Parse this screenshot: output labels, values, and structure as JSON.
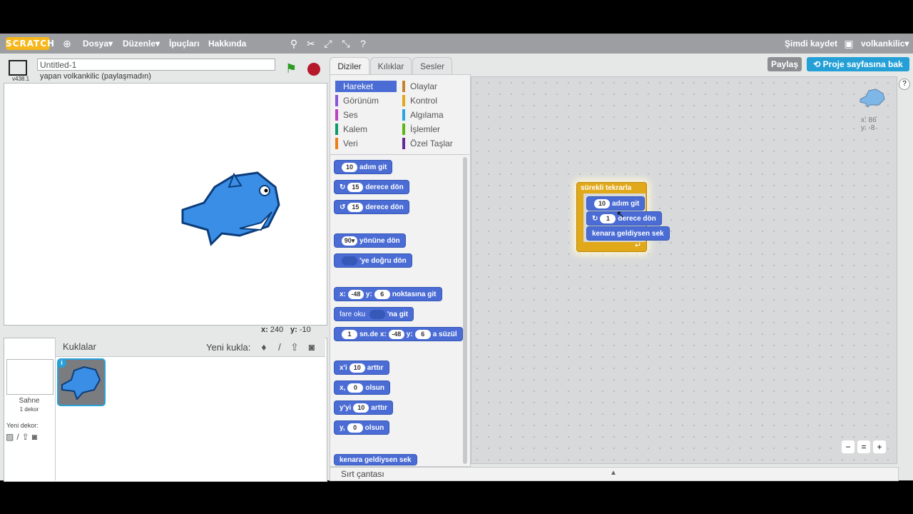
{
  "menu": {
    "logo": "SCRATCH",
    "file": "Dosya▾",
    "edit": "Düzenle▾",
    "tips": "İpuçları",
    "about": "Hakkında",
    "save_now": "Şimdi kaydet",
    "user": "volkankilic▾"
  },
  "toolbar_icons": [
    "duplicate-icon",
    "delete-icon",
    "grow-icon",
    "shrink-icon",
    "help-icon"
  ],
  "stage": {
    "title": "Untitled-1",
    "version": "v438.1",
    "author": "yapan volkankilic (paylaşmadın)",
    "x_label": "x:",
    "x_val": "240",
    "y_label": "y:",
    "y_val": "-10"
  },
  "tabs": [
    "Diziler",
    "Kılıklar",
    "Sesler"
  ],
  "buttons": {
    "share": "Paylaş",
    "project_page": "Proje sayfasına bak"
  },
  "categories_left": [
    {
      "label": "Hareket",
      "color": "#4a6cd4"
    },
    {
      "label": "Görünüm",
      "color": "#8a55d7"
    },
    {
      "label": "Ses",
      "color": "#bb42c3"
    },
    {
      "label": "Kalem",
      "color": "#0e9a6c"
    },
    {
      "label": "Veri",
      "color": "#ee7d16"
    }
  ],
  "categories_right": [
    {
      "label": "Olaylar",
      "color": "#c88330"
    },
    {
      "label": "Kontrol",
      "color": "#e1a91a"
    },
    {
      "label": "Algılama",
      "color": "#2ca5e2"
    },
    {
      "label": "İşlemler",
      "color": "#5cb712"
    },
    {
      "label": "Özel Taşlar",
      "color": "#632d99"
    }
  ],
  "blocks": {
    "b1_val": "10",
    "b1_txt": "adım git",
    "b2_val": "15",
    "b2_txt": "derece dön",
    "b3_val": "15",
    "b3_txt": "derece dön",
    "b4_val": "90▾",
    "b4_txt": "yönüne dön",
    "b5_txt": "'ye doğru dön",
    "b6_x": "x:",
    "b6_xv": "-48",
    "b6_y": "y:",
    "b6_yv": "6",
    "b6_txt": "noktasına git",
    "b7_a": "fare oku",
    "b7_b": "'na git",
    "b8_v": "1",
    "b8_a": "sn.de x:",
    "b8_xv": "-48",
    "b8_y": "y:",
    "b8_yv": "6",
    "b8_txt": "a süzül",
    "b9_a": "x'i",
    "b9_v": "10",
    "b9_b": "arttır",
    "b10_a": "x,",
    "b10_v": "0",
    "b10_b": "olsun",
    "b11_a": "y'yi",
    "b11_v": "10",
    "b11_b": "arttır",
    "b12_a": "y,",
    "b12_v": "0",
    "b12_b": "olsun",
    "b13": "kenara geldiysen sek"
  },
  "script": {
    "forever": "sürekli tekrarla",
    "move_val": "10",
    "move_txt": "adım git",
    "turn_val": "1",
    "turn_txt": "derece dön",
    "bounce": "kenara geldiysen sek",
    "sprite_x": "x: 86",
    "sprite_y": "y: -8"
  },
  "sprites": {
    "header": "Kuklalar",
    "new_sprite": "Yeni kukla:",
    "stage_label": "Sahne",
    "stage_sub": "1 dekor",
    "new_backdrop": "Yeni dekor:"
  },
  "backpack": "Sırt çantası"
}
